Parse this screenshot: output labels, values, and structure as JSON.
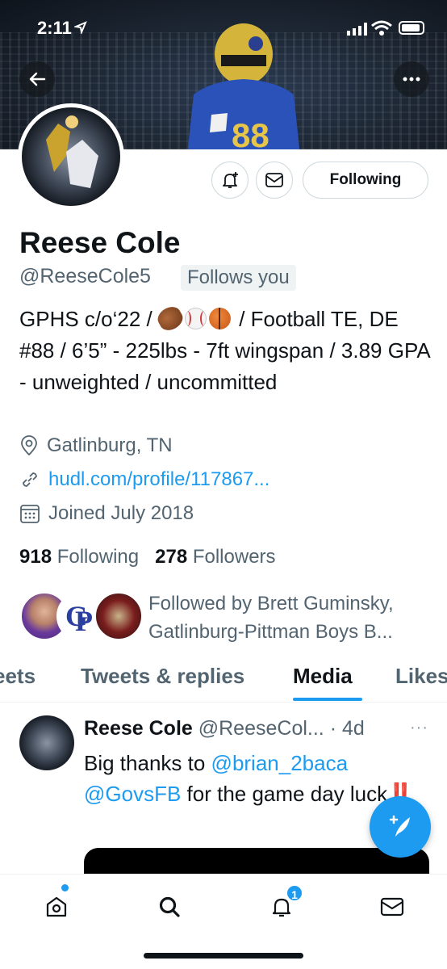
{
  "status_bar": {
    "time": "2:11"
  },
  "profile": {
    "name": "Reese Cole",
    "handle": "@ReeseCole5",
    "follows_you": "Follows you",
    "following_button": "Following",
    "bio": {
      "line1_pre": "GPHS c/o‘22 / ",
      "line1_post": " / Football TE,",
      "rest": "DE #88 / 6’5” - 225lbs - 7ft wingspan / 3.89 GPA - unweighted / uncommitted"
    },
    "location": "Gatlinburg, TN",
    "link": "hudl.com/profile/117867...",
    "joined": "Joined July 2018",
    "following_count": "918",
    "following_label": "Following",
    "followers_count": "278",
    "followers_label": "Followers",
    "followed_by": "Followed by Brett Guminsky, Gatlinburg-Pittman Boys B..."
  },
  "tabs": [
    {
      "label": "eets"
    },
    {
      "label": "Tweets & replies"
    },
    {
      "label": "Media"
    },
    {
      "label": "Likes"
    }
  ],
  "active_tab": "Media",
  "tweet": {
    "name": "Reese Cole",
    "handle_time": "@ReeseCol... · 4d",
    "text_pre": "Big thanks to ",
    "mention1": "@brian_2baca",
    "mention2": "@GovsFB",
    "text_post": " for the game day luck",
    "exclaim": "‼️",
    "more": "···"
  },
  "nav": {
    "notification_count": "1"
  },
  "colors": {
    "accent": "#1d9bf0",
    "text_primary": "#0f1419",
    "text_secondary": "#536471"
  },
  "icons": [
    "back-arrow-icon",
    "more-icon",
    "add-notification-icon",
    "mail-icon",
    "location-icon",
    "link-icon",
    "calendar-icon",
    "compose-icon",
    "home-icon",
    "search-icon",
    "notification-icon",
    "messages-icon"
  ]
}
